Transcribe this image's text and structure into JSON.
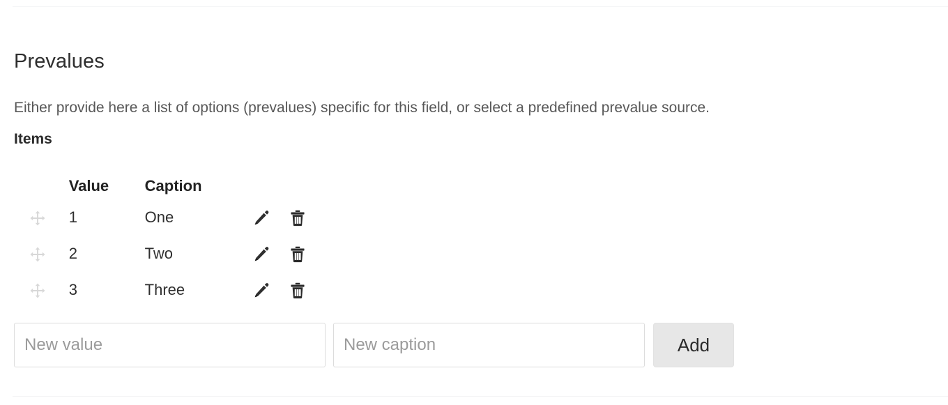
{
  "section": {
    "title": "Prevalues",
    "description": "Either provide here a list of options (prevalues) specific for this field, or select a predefined prevalue source.",
    "items_label": "Items"
  },
  "table": {
    "columns": {
      "handle": "",
      "value": "Value",
      "caption": "Caption"
    },
    "rows": [
      {
        "value": "1",
        "caption": "One",
        "drag_icon": "move-icon",
        "edit_icon": "pencil-icon",
        "delete_icon": "trash-icon"
      },
      {
        "value": "2",
        "caption": "Two",
        "drag_icon": "move-icon",
        "edit_icon": "pencil-icon",
        "delete_icon": "trash-icon"
      },
      {
        "value": "3",
        "caption": "Three",
        "drag_icon": "move-icon",
        "edit_icon": "pencil-icon",
        "delete_icon": "trash-icon"
      }
    ]
  },
  "add_form": {
    "new_value": {
      "value": "",
      "placeholder": "New value"
    },
    "new_caption": {
      "value": "",
      "placeholder": "New caption"
    },
    "add_label": "Add"
  },
  "colors": {
    "background": "#ffffff",
    "heading_text": "#2e2e2e",
    "body_text": "#585858",
    "placeholder_text": "#9b9b9b",
    "input_border": "#dcdcdc",
    "button_bg": "#e7e7e7",
    "drag_handle": "#d6d6d6",
    "icon_dark": "#2b2b2b",
    "divider": "#f2f3f4"
  }
}
